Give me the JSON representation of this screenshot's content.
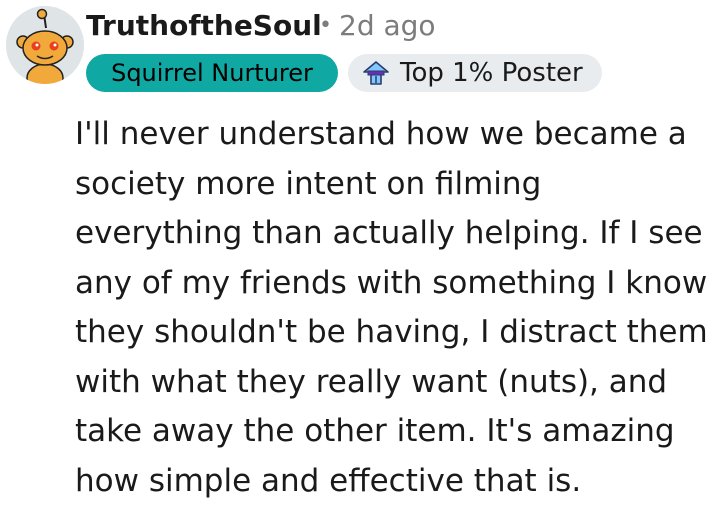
{
  "author": {
    "username": "TruthoftheSoul",
    "avatar_icon": "snoo-avatar-icon"
  },
  "meta": {
    "separator": "•",
    "timestamp": "2d ago"
  },
  "flairs": {
    "user_flair": "Squirrel Nurturer",
    "user_flair_color": "#10a8a3",
    "badge_label": "Top 1% Poster",
    "badge_icon": "top-poster-badge-icon"
  },
  "comment": {
    "lines": [
      "I'll never understand how we became a",
      "society more intent on filming",
      "everything than actually helping. If I see",
      "any of my friends with something I know",
      "they shouldn't be having, I distract them",
      "with what they really want (nuts), and",
      "take away the other item. It's amazing",
      "how simple and effective that is."
    ]
  }
}
